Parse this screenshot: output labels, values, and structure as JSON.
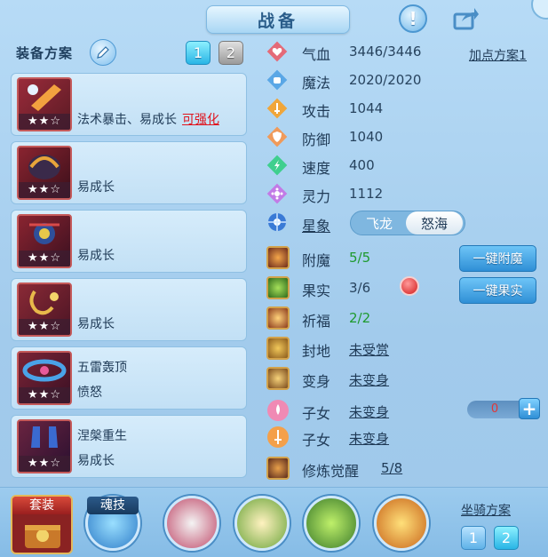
{
  "header": {
    "title": "战备",
    "help_glyph": "!"
  },
  "equipment": {
    "title": "装备方案",
    "tabs": [
      "1",
      "2"
    ],
    "items": [
      {
        "line1": "法术暴击、易成长",
        "enhance": "可强化",
        "line2": "",
        "stars": "★★☆",
        "color": "#7a2030"
      },
      {
        "line1": "",
        "line2": "易成长",
        "stars": "★★☆",
        "color": "#5a1a2a"
      },
      {
        "line1": "",
        "line2": "易成长",
        "stars": "★★☆",
        "color": "#6a1e30"
      },
      {
        "line1": "",
        "line2": "易成长",
        "stars": "★★☆",
        "color": "#6e2a34"
      },
      {
        "line1": "五雷轰顶",
        "line2": "愤怒",
        "stars": "★★☆",
        "color": "#5a2038"
      },
      {
        "line1": "涅槃重生",
        "line2": "易成长",
        "stars": "★★☆",
        "color": "#4a2040"
      }
    ]
  },
  "stats": [
    {
      "label": "气血",
      "value": "3446/3446",
      "icon": "heart-icon",
      "color": "#e46a78"
    },
    {
      "label": "魔法",
      "value": "2020/2020",
      "icon": "mana-icon",
      "color": "#5aa7e6"
    },
    {
      "label": "攻击",
      "value": "1044",
      "icon": "sword-icon",
      "color": "#f0a63a"
    },
    {
      "label": "防御",
      "value": "1040",
      "icon": "shield-icon",
      "color": "#f09a5a"
    },
    {
      "label": "速度",
      "value": "400",
      "icon": "speed-icon",
      "color": "#3fcf8e"
    },
    {
      "label": "灵力",
      "value": "1112",
      "icon": "spirit-icon",
      "color": "#c27be6"
    }
  ],
  "add_point_label": "加点方案1",
  "star_sign": {
    "label": "星象",
    "options": [
      "飞龙",
      "怒海"
    ]
  },
  "features": [
    {
      "label": "附魔",
      "value": "5/5",
      "style": "green",
      "icon": "enchant-icon"
    },
    {
      "label": "果实",
      "value": "3/6",
      "style": "plain",
      "icon": "fruit-icon"
    },
    {
      "label": "祈福",
      "value": "2/2",
      "style": "green",
      "icon": "blessing-icon"
    },
    {
      "label": "封地",
      "value": "未受赏",
      "style": "link",
      "icon": "fief-icon"
    },
    {
      "label": "变身",
      "value": "未变身",
      "style": "link",
      "icon": "transform-icon"
    },
    {
      "label": "子女",
      "value": "未变身",
      "style": "link",
      "icon": "child-lotus-icon"
    },
    {
      "label": "子女",
      "value": "未变身",
      "style": "link",
      "icon": "child-sword-icon"
    },
    {
      "label": "修炼觉醒",
      "value": "5/8",
      "style": "link",
      "icon": "awaken-icon"
    }
  ],
  "buttons": {
    "enchant_all": "一键附魔",
    "fruit_all": "一键果实"
  },
  "counter": {
    "value": "0",
    "plus": "+"
  },
  "bottom": {
    "suit_label": "套装",
    "soul_label": "魂技",
    "mount_label": "坐骑方案",
    "mount_tabs": [
      "1",
      "2"
    ]
  }
}
